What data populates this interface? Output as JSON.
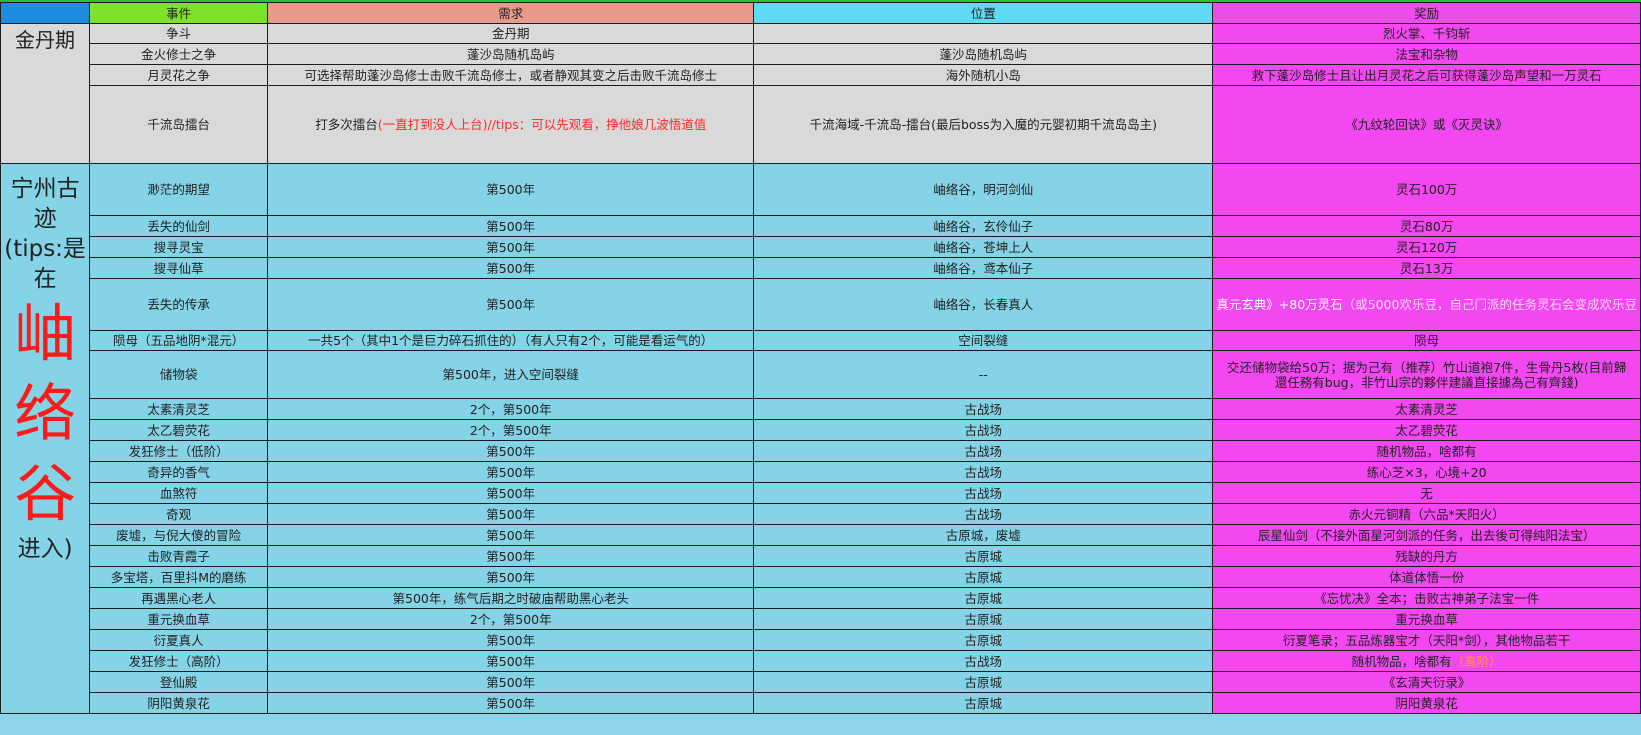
{
  "headers": {
    "c0": "",
    "c1": "事件",
    "c2": "需求",
    "c3": "位置",
    "c4": "奖励"
  },
  "sections": {
    "jindan": {
      "title": "金丹期"
    },
    "ningzhou": {
      "title_line1": "宁州古迹",
      "title_line2": "(tips:是",
      "title_line3": "在",
      "big1": "岫",
      "big2": "络",
      "big3": "谷",
      "tail": "进入)"
    }
  },
  "jindan_rows": [
    {
      "event": "争斗",
      "req": "金丹期",
      "loc": "",
      "reward": "烈火掌、千钧斩"
    },
    {
      "event": "金火修士之争",
      "req": "蓬沙岛随机岛屿",
      "loc": "蓬沙岛随机岛屿",
      "reward": "法宝和杂物"
    },
    {
      "event": "月灵花之争",
      "req": "可选择帮助蓬沙岛修士击败千流岛修士，或者静观其变之后击败千流岛修士",
      "loc": "海外随机小岛",
      "reward": "救下蓬沙岛修士且让出月灵花之后可获得蓬沙岛声望和一万灵石"
    },
    {
      "event": "千流岛擂台",
      "req_a": "打多次擂台",
      "req_b": "(一直打到没人上台)//tips：可以先观看，挣他娘几波悟道值",
      "loc": "千流海域-千流岛-擂台(最后boss为入魔的元婴初期千流岛岛主)",
      "reward": "《九纹轮回诀》或《灭灵诀》"
    }
  ],
  "ningzhou_rows": [
    {
      "event": "渺茫的期望",
      "req": "第500年",
      "loc": "岫络谷，明河剑仙",
      "reward": "灵石100万"
    },
    {
      "event": "丢失的仙剑",
      "req": "第500年",
      "loc": "岫络谷，玄伶仙子",
      "reward": "灵石80万"
    },
    {
      "event": "搜寻灵宝",
      "req": "第500年",
      "loc": "岫络谷，苍坤上人",
      "reward": "灵石120万"
    },
    {
      "event": "搜寻仙草",
      "req": "第500年",
      "loc": "岫络谷，鸢本仙子",
      "reward": "灵石13万"
    },
    {
      "event": "丢失的传承",
      "req": "第500年",
      "loc": "岫络谷，长春真人",
      "reward_a": "真元玄典》+80万灵石",
      "reward_b": "（或5000欢乐豆，自己门派的任务灵石会变成欢乐豆"
    },
    {
      "event": "陨母（五品地阴*混元）",
      "req": "一共5个（其中1个是巨力碎石抓住的）（有人只有2个，可能是看运气的）",
      "loc": "空间裂缝",
      "reward": "陨母"
    },
    {
      "event": "储物袋",
      "req": "第500年，进入空间裂缝",
      "loc": "--",
      "reward_l1": "交还储物袋给50万；据为己有（推荐）竹山道袍7件，生骨丹5枚(目前歸",
      "reward_l2": "還任務有bug，非竹山宗的夥伴建議直接據為己有齊錢)"
    },
    {
      "event": "太素清灵芝",
      "req": "2个，第500年",
      "loc": "古战场",
      "reward": "太素清灵芝"
    },
    {
      "event": "太乙碧荧花",
      "req": "2个，第500年",
      "loc": "古战场",
      "reward": "太乙碧荧花"
    },
    {
      "event": "发狂修士（低阶）",
      "req": "第500年",
      "loc": "古战场",
      "reward": "随机物品，啥都有"
    },
    {
      "event": "奇异的香气",
      "req": "第500年",
      "loc": "古战场",
      "reward": "练心芝×3，心境+20"
    },
    {
      "event": "血煞符",
      "req": "第500年",
      "loc": "古战场",
      "reward": "无"
    },
    {
      "event": "奇观",
      "req": "第500年",
      "loc": "古战场",
      "reward": "赤火元铜精（六品*天阳火）"
    },
    {
      "event": "废墟，与倪大傻的冒险",
      "req": "第500年",
      "loc": "古原城，废墟",
      "reward": "辰星仙剑（不接外面星河剑派的任务，出去後可得纯阳法宝）"
    },
    {
      "event": "击败青霞子",
      "req": "第500年",
      "loc": "古原城",
      "reward": "残缺的丹方"
    },
    {
      "event": "多宝塔，百里抖M的磨练",
      "req": "第500年",
      "loc": "古原城",
      "reward": "体道体悟一份"
    },
    {
      "event": "再遇黑心老人",
      "req": "第500年，练气后期之时破庙帮助黑心老头",
      "loc": "古原城",
      "reward": "《忘忧决》全本；击败古神弟子法宝一件"
    },
    {
      "event": "重元换血草",
      "req": "2个，第500年",
      "loc": "古原城",
      "reward": "重元换血草"
    },
    {
      "event": "衍夏真人",
      "req": "第500年",
      "loc": "古原城",
      "reward": "衍夏笔录；五品炼器宝才（天阳*剑），其他物品若干"
    },
    {
      "event": "发狂修士（高阶）",
      "req": "第500年",
      "loc": "古战场",
      "reward_a": "随机物品，啥都有",
      "reward_b": "（高阶）"
    },
    {
      "event": "登仙殿",
      "req": "第500年",
      "loc": "古原城",
      "reward": "《玄清天衍录》"
    },
    {
      "event": "阴阳黄泉花",
      "req": "第500年",
      "loc": "古原城",
      "reward": "阴阳黄泉花"
    }
  ],
  "colors": {
    "header_event": "#7ee22a",
    "header_req": "#e99a8d",
    "header_loc": "#60d9f2",
    "header_reward": "#e94fe8",
    "grey_row": "#d9d9d9",
    "blue_row": "#84d3e6",
    "pink_cell": "#f247f1",
    "red_text": "#ff1a1a"
  }
}
